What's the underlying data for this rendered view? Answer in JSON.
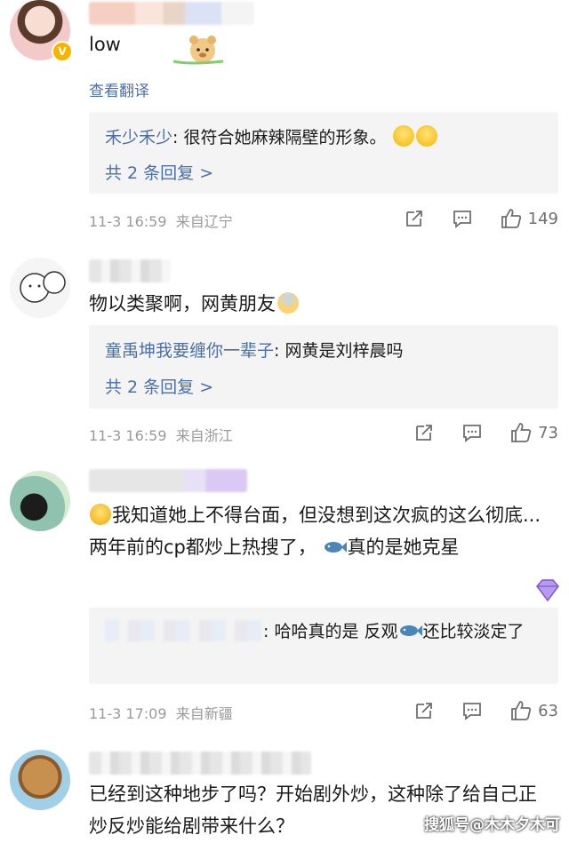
{
  "comments": [
    {
      "text": "low",
      "translate": "查看翻译",
      "reply": {
        "user": "禾少禾少",
        "sep": ":",
        "text": " 很符合她麻辣隔壁的形象。",
        "count": "共 2 条回复 >"
      },
      "time": "11-3 16:59",
      "location": "来自辽宁",
      "likes": "149"
    },
    {
      "text": "物以类聚啊，网黄朋友",
      "reply": {
        "user": "童禹坤我要缠你一辈子",
        "sep": ":",
        "text": " 网黄是刘梓晨吗",
        "count": "共 2 条回复 >"
      },
      "time": "11-3 16:59",
      "location": "来自浙江",
      "likes": "73"
    },
    {
      "text_a": "我知道她上不得台面，但没想到这次疯的这么彻底...两年前的cp都炒上热搜了，",
      "text_b": "真的是她克星",
      "reply": {
        "sep": ":",
        "text_a": " 哈哈真的是 反观",
        "text_b": "还比较淡定了"
      },
      "time": "11-3 17:09",
      "location": "来自新疆",
      "likes": "63"
    },
    {
      "text": "已经到这种地步了吗？开始剧外炒，这种除了给自己正炒反炒能给剧带来什么？"
    }
  ],
  "watermark": "搜狐号@木木夕木可",
  "icons": {
    "share": "share-icon",
    "comment": "comment-icon",
    "like": "like-icon",
    "verified": "verified-badge-icon",
    "gem": "gem-badge-icon"
  },
  "colors": {
    "link": "#4a6fa8",
    "meta": "#9a9a9a",
    "reply_bg": "#f4f4f4"
  }
}
